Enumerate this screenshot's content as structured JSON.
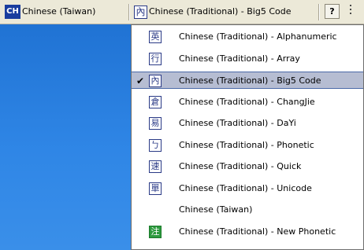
{
  "language_bar": {
    "language_badge": "CH",
    "language_label": "Chinese (Taiwan)",
    "ime_icon": "內",
    "ime_label": "Chinese (Traditional) - Big5 Code",
    "help_icon": "?"
  },
  "menu": {
    "items": [
      {
        "icon": "英",
        "label": "Chinese (Traditional) - Alphanumeric",
        "checked": false
      },
      {
        "icon": "行",
        "label": "Chinese (Traditional) - Array",
        "checked": false
      },
      {
        "icon": "內",
        "label": "Chinese (Traditional) - Big5 Code",
        "checked": true
      },
      {
        "icon": "倉",
        "label": "Chinese (Traditional) - ChangJie",
        "checked": false
      },
      {
        "icon": "易",
        "label": "Chinese (Traditional) - DaYi",
        "checked": false
      },
      {
        "icon": "ㄅ",
        "label": "Chinese (Traditional) - Phonetic",
        "checked": false
      },
      {
        "icon": "速",
        "label": "Chinese (Traditional) - Quick",
        "checked": false
      },
      {
        "icon": "單",
        "label": "Chinese (Traditional) - Unicode",
        "checked": false
      },
      {
        "icon": "",
        "label": "Chinese (Taiwan)",
        "checked": false
      },
      {
        "icon": "注",
        "label": "Chinese (Traditional) - New Phonetic",
        "checked": false
      }
    ],
    "check_mark": "✔"
  },
  "colors": {
    "desktop_blue": "#2f86e6",
    "selection": "#b6bdd2",
    "badge_blue": "#1a3d9e"
  }
}
